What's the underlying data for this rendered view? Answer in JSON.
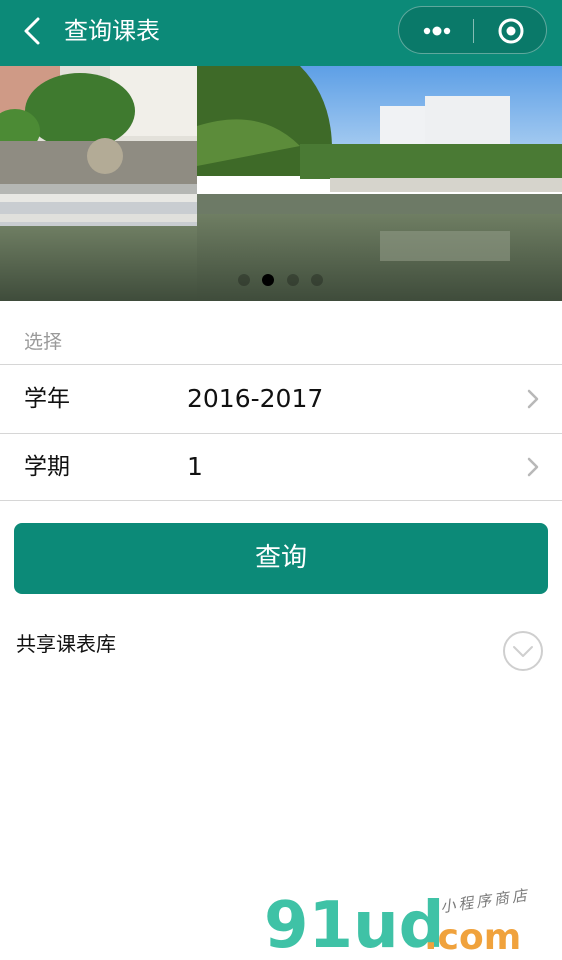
{
  "header": {
    "title": "查询课表",
    "back_icon": "chevron-left-icon",
    "menu_icon": "more-dots-icon",
    "close_icon": "target-circle-icon",
    "accent_color": "#0c8a78"
  },
  "banner": {
    "slide_count": 4,
    "active_index": 1
  },
  "selection": {
    "section_label": "选择",
    "rows": [
      {
        "label": "学年",
        "value": "2016-2017"
      },
      {
        "label": "学期",
        "value": "1"
      }
    ]
  },
  "actions": {
    "query_label": "查询"
  },
  "shared": {
    "title": "共享课表库",
    "expand_icon": "chevron-down-circle-icon"
  },
  "watermark": {
    "domain": "91ud.com",
    "subtitle": "小程序商店"
  }
}
